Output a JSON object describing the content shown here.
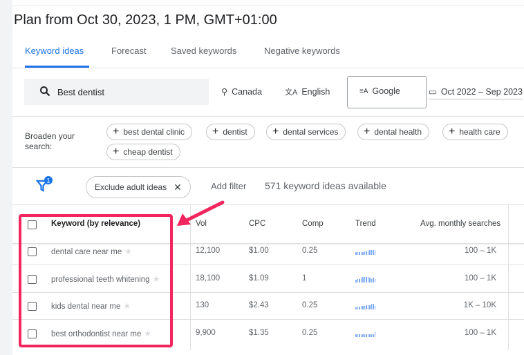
{
  "title": "Plan from Oct 30, 2023, 1 PM, GMT+01:00",
  "tabs": [
    {
      "label": "Keyword ideas",
      "active": true
    },
    {
      "label": "Forecast"
    },
    {
      "label": "Saved keywords"
    },
    {
      "label": "Negative keywords"
    }
  ],
  "search": {
    "value": "Best dentist",
    "location": "Canada",
    "language": "English",
    "network": "Google",
    "date_range": "Oct 2022 – Sep 2023"
  },
  "broaden": {
    "label": "Broaden your search:",
    "chips": [
      "best dental clinic",
      "dentist",
      "dental services",
      "dental health",
      "health care",
      "cheap dentist"
    ]
  },
  "filters": {
    "badge": "1",
    "chip": "Exclude adult ideas",
    "add_filter": "Add filter",
    "count_text": "571 keyword ideas available"
  },
  "table": {
    "headers": {
      "keyword": "Keyword (by relevance)",
      "vol": "Vol",
      "cpc": "CPC",
      "comp": "Comp",
      "trend": "Trend",
      "avg": "Avg. monthly searches"
    },
    "rows": [
      {
        "keyword": "dental care near me",
        "vol": "12,100",
        "cpc": "$1.00",
        "comp": "0.25",
        "avg": "100 – 1K"
      },
      {
        "keyword": "professional teeth whitening",
        "vol": "18,100",
        "cpc": "$1.09",
        "comp": "1",
        "avg": "100 – 1K"
      },
      {
        "keyword": "kids dental near me",
        "vol": "130",
        "cpc": "$2.43",
        "comp": "0.25",
        "avg": "1K – 10K"
      },
      {
        "keyword": "best orthodontist near me",
        "vol": "9,900",
        "cpc": "$1.35",
        "comp": "0.25",
        "avg": "100 – 1K"
      }
    ]
  },
  "colors": {
    "accent": "#1a73e8",
    "highlight": "#f2255e",
    "trend": "#7baaf7"
  }
}
